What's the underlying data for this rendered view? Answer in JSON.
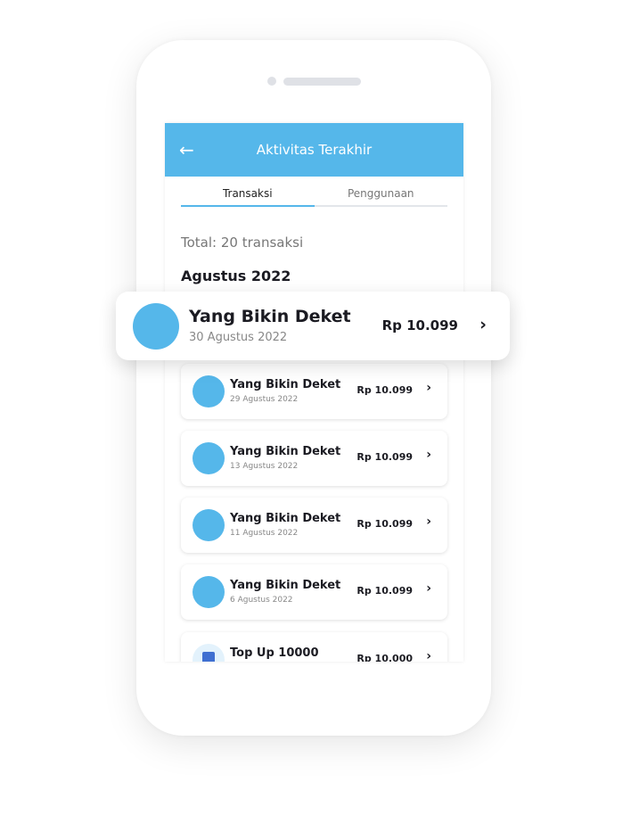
{
  "header": {
    "title": "Aktivitas Terakhir",
    "back_icon": "arrow-left-icon"
  },
  "tabs": [
    {
      "label": "Transaksi",
      "active": true
    },
    {
      "label": "Penggunaan",
      "active": false
    }
  ],
  "total": "Total: 20 transaksi",
  "month": "Agustus 2022",
  "featured": {
    "name": "Yang Bikin Deket",
    "date": "30 Agustus 2022",
    "amount": "Rp 10.099"
  },
  "transactions": [
    {
      "name": "Yang Bikin Deket",
      "date": "29 Agustus 2022",
      "amount": "Rp 10.099"
    },
    {
      "name": "Yang Bikin Deket",
      "date": "13 Agustus 2022",
      "amount": "Rp 10.099"
    },
    {
      "name": "Yang Bikin Deket",
      "date": "11 Agustus 2022",
      "amount": "Rp 10.099"
    },
    {
      "name": "Yang Bikin Deket",
      "date": "6 Agustus 2022",
      "amount": "Rp 10.099"
    },
    {
      "name": "Top Up 10000",
      "date": "",
      "amount": "Rp 10.000"
    }
  ],
  "colors": {
    "accent": "#55b7ea"
  }
}
